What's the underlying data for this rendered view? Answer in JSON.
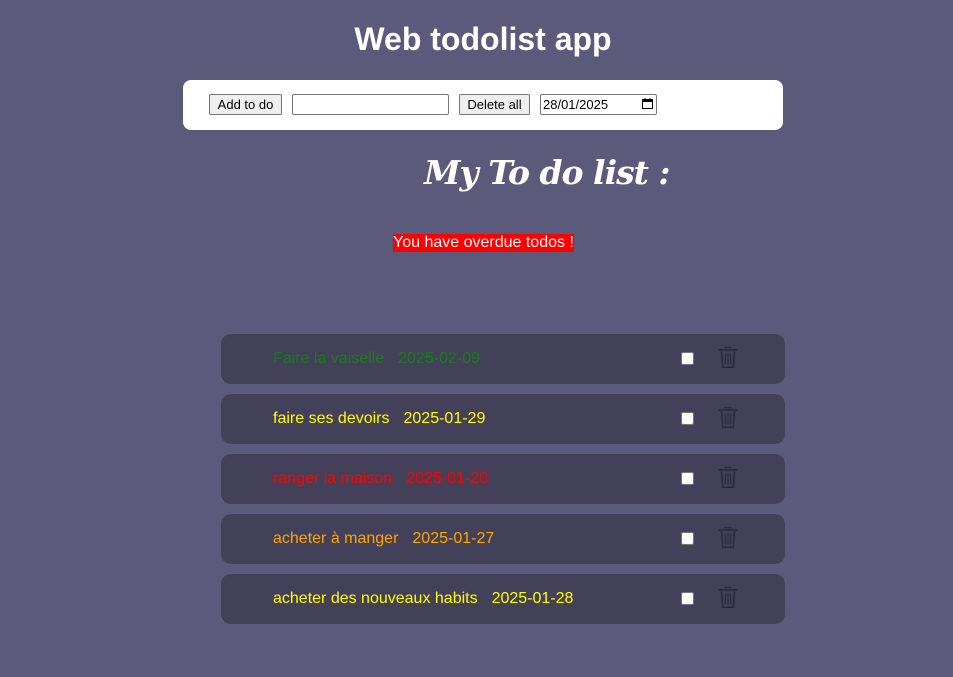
{
  "app_title": "Web todolist app",
  "toolbar": {
    "add_label": "Add to do",
    "input_value": "",
    "delete_all_label": "Delete all",
    "date_value": "28/01/2025"
  },
  "list_title": "My To do list :",
  "overdue_message": "You have overdue todos !",
  "todos": [
    {
      "text": "Faire la vaiselle",
      "date": "2025-02-09",
      "color": "#1a7a1a"
    },
    {
      "text": "faire ses devoirs",
      "date": "2025-01-29",
      "color": "#ffff00"
    },
    {
      "text": "ranger la maison",
      "date": "2025-01-20",
      "color": "#ff0000"
    },
    {
      "text": "acheter à manger",
      "date": "2025-01-27",
      "color": "#ffa500"
    },
    {
      "text": "acheter des nouveaux habits",
      "date": "2025-01-28",
      "color": "#ffff00"
    }
  ]
}
